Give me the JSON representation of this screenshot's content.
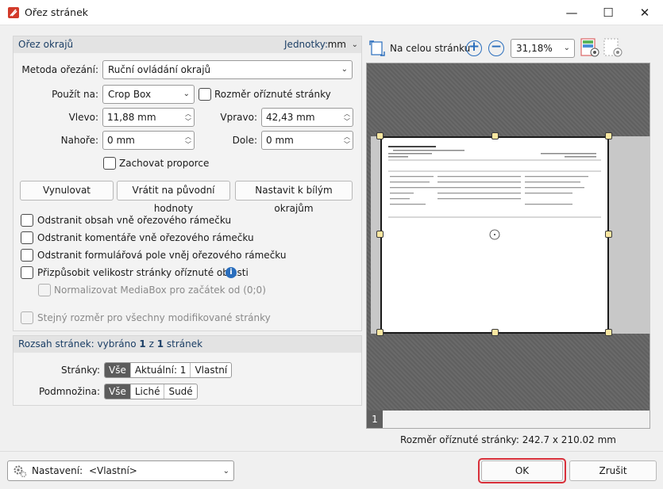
{
  "window": {
    "title": "Ořez stránek",
    "minimize": "—",
    "maximize": "☐",
    "close": "✕"
  },
  "crop_margins": {
    "header": "Ořez okrajů",
    "units_label": "Jednotky:",
    "units_value": "mm",
    "method_label": "Metoda ořezání:",
    "method_value": "Ruční ovládání okrajů",
    "apply_label": "Použít na:",
    "apply_value": "Crop Box",
    "cropped_size_checkbox": "Rozměr oříznuté stránky",
    "left_label": "Vlevo:",
    "left_value": "11,88 mm",
    "right_label": "Vpravo:",
    "right_value": "42,43 mm",
    "top_label": "Nahoře:",
    "top_value": "0 mm",
    "bottom_label": "Dole:",
    "bottom_value": "0 mm",
    "keep_ratio": "Zachovat proporce",
    "reset_button": "Vynulovat",
    "revert_button": "Vrátit na původní hodnoty",
    "white_margins_button": "Nastavit k bílým okrajům",
    "opt_remove_content": "Odstranit obsah vně ořezového rámečku",
    "opt_remove_comments": "Odstranit komentáře vně ořezového rámečku",
    "opt_remove_forms": "Odstranit formulářová pole vněj ořezového rámečku",
    "opt_fit_size": "Přizpůsobit velikostr stránky oříznuté oblasti",
    "opt_normalize": "Normalizovat MediaBox pro začátek od (0;0)",
    "opt_same_size": "Stejný rozměr pro všechny modifikované stránky"
  },
  "page_range": {
    "header_prefix": "Rozsah stránek: vybráno",
    "selected": "1",
    "of": "z",
    "total": "1",
    "suffix": "stránek",
    "pages_label": "Stránky:",
    "pages_options": [
      "Vše",
      "Aktuální: 1",
      "Vlastní"
    ],
    "subset_label": "Podmnožina:",
    "subset_options": [
      "Vše",
      "Liché",
      "Sudé"
    ]
  },
  "preview": {
    "fit_label": "Na celou stránku",
    "zoom_in": "+",
    "zoom_out": "−",
    "zoom_value": "31,18%",
    "page_number": "1",
    "cropped_size": "Rozměr oříznuté stránky: 242.7 x 210.02 mm"
  },
  "footer": {
    "settings_label": "Nastavení:",
    "settings_value": "<Vlastní>",
    "ok": "OK",
    "cancel": "Zrušit"
  },
  "colors": {
    "accent": "#2a6ebd",
    "ok_highlight": "#d8303a",
    "handle": "#fbe7a1"
  }
}
